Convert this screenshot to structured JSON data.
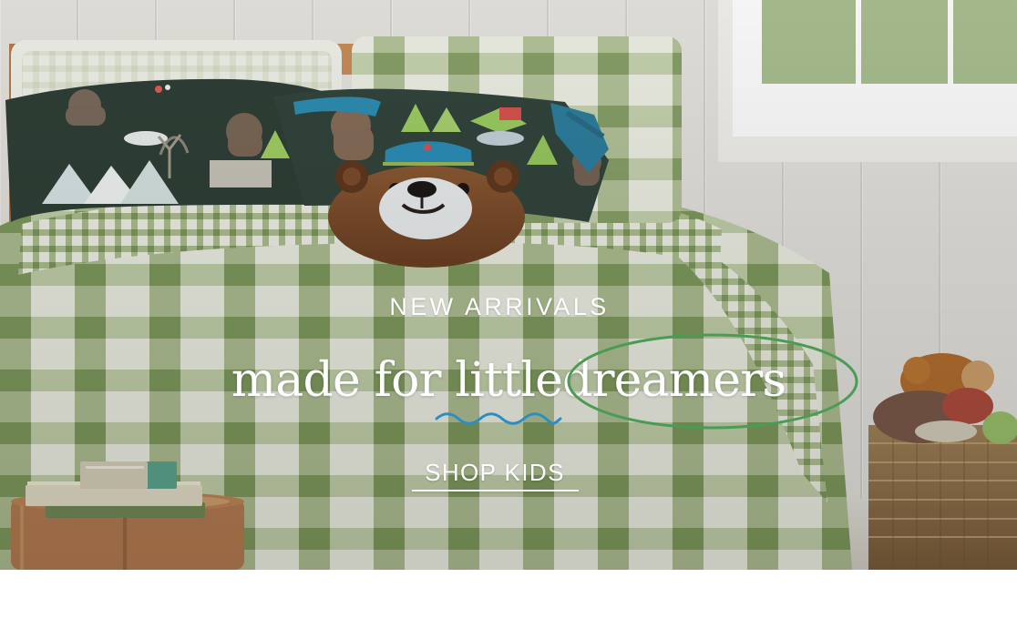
{
  "hero": {
    "eyebrow": "NEW ARRIVALS",
    "headline": {
      "prefix": "made for little ",
      "highlight": "dreamers"
    },
    "cta_label": "SHOP KIDS"
  },
  "colors": {
    "text": "#ffffff",
    "highlight_ellipse": "#4b9b55",
    "wave_accent": "#2b8ec0",
    "plaid_light": "#e9ecdf",
    "plaid_mid": "#9fb37a",
    "plaid_dark": "#6f8d4c"
  },
  "icons": {
    "bear_pillow": "bear-face-pillow",
    "highlight_ellipse": "circle-outline",
    "wave": "wavy-underline"
  }
}
